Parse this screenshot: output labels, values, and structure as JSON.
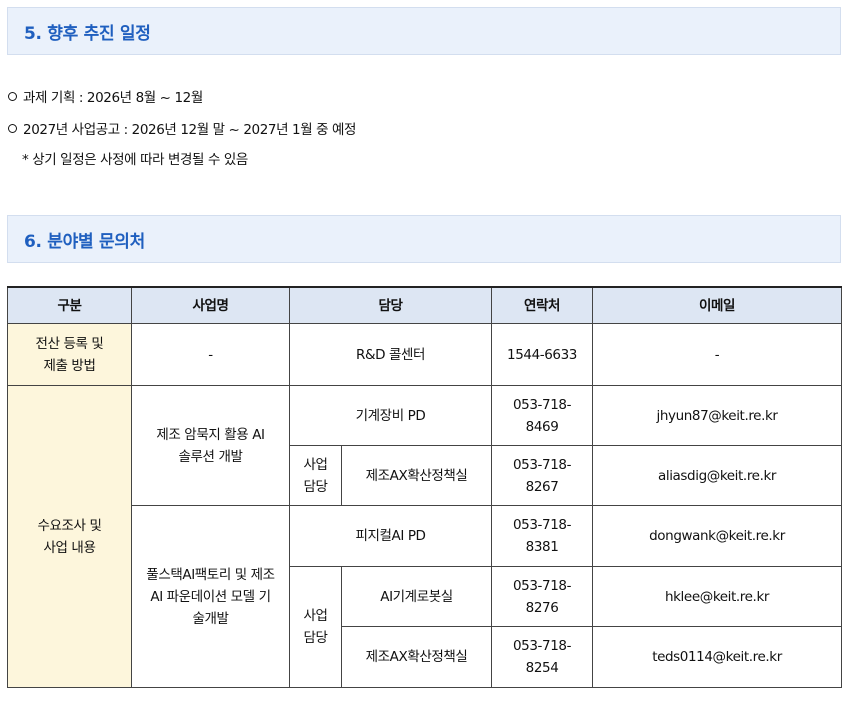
{
  "section5": {
    "title": "5. 향후 추진 일정",
    "items": [
      "과제 기획 : 2026년 8월 ~ 12월",
      "2027년 사업공고 : 2026년 12월 말 ~ 2027년 1월 중 예정"
    ],
    "note": "* 상기 일정은 사정에 따라 변경될 수 있음"
  },
  "section6": {
    "title": "6. 분야별 문의처",
    "table": {
      "headers": [
        "구분",
        "사업명",
        "담당",
        "연락처",
        "이메일"
      ],
      "row1": {
        "category": "전산 등록 및 제출 방법",
        "business": "-",
        "contact": "R&D 콜센터",
        "phone": "1544-6633",
        "email": "-"
      },
      "category2": "수요조사 및 사업 내용",
      "group1": {
        "business": "제조 암묵지 활용 AI 솔루션 개발",
        "rows": [
          {
            "contact": "기계장비 PD",
            "phone": "053-718-8469",
            "email": "jhyun87@keit.re.kr"
          },
          {
            "sub": "사업 담당",
            "contact": "제조AX확산정책실",
            "phone": "053-718-8267",
            "email": "aliasdig@keit.re.kr"
          }
        ]
      },
      "group2": {
        "business": "풀스택AI팩토리 및 제조AI 파운데이션 모델 기술개발",
        "rows": [
          {
            "contact": "피지컬AI PD",
            "phone": "053-718-8381",
            "email": "dongwank@keit.re.kr"
          },
          {
            "sub": "사업 담당",
            "contact": "AI기계로봇실",
            "phone": "053-718-8276",
            "email": "hklee@keit.re.kr"
          },
          {
            "contact": "제조AX확산정책실",
            "phone": "053-718-8254",
            "email": "teds0114@keit.re.kr"
          }
        ]
      }
    }
  }
}
